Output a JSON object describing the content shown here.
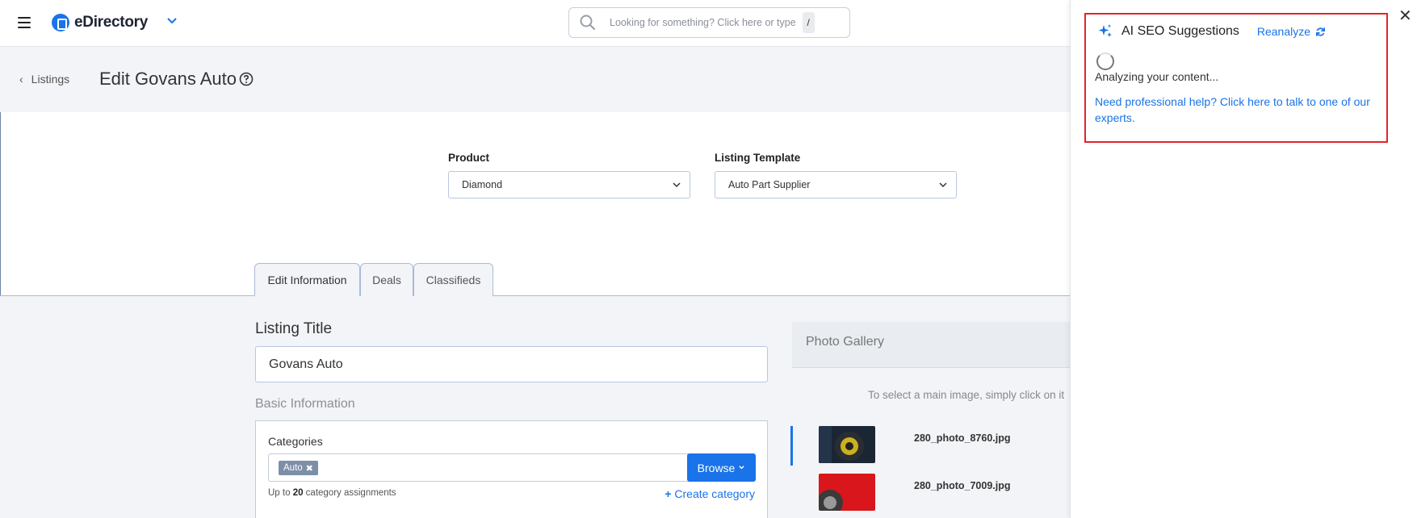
{
  "header": {
    "brand": "eDirectory",
    "search_placeholder": "Looking for something? Click here or type",
    "search_shortcut": "/"
  },
  "page": {
    "back_label": "Listings",
    "title": "Edit Govans Auto"
  },
  "selectors": {
    "product_label": "Product",
    "product_value": "Diamond",
    "template_label": "Listing Template",
    "template_value": "Auto Part Supplier"
  },
  "tabs": [
    {
      "label": "Edit Information",
      "active": true
    },
    {
      "label": "Deals",
      "active": false
    },
    {
      "label": "Classifieds",
      "active": false
    }
  ],
  "form": {
    "listing_title_label": "Listing Title",
    "listing_title_value": "Govans Auto",
    "basic_info_label": "Basic Information",
    "categories_label": "Categories",
    "category_chips": [
      "Auto"
    ],
    "browse_label": "Browse",
    "hint_prefix": "Up to ",
    "hint_count": "20",
    "hint_suffix": " category assignments",
    "create_category_label": "Create category"
  },
  "gallery": {
    "title": "Photo Gallery",
    "hint": "To select a main image, simply click on it",
    "photos": [
      {
        "name": "280_photo_8760.jpg"
      },
      {
        "name": "280_photo_7009.jpg"
      }
    ]
  },
  "ai_panel": {
    "title": "AI SEO Suggestions",
    "reanalyze_label": "Reanalyze",
    "status": "Analyzing your content...",
    "help_link": "Need professional help? Click here to talk to one of our experts.",
    "close_glyph": "✕"
  },
  "colors": {
    "accent": "#1a73e8",
    "highlight_border": "#e3242b",
    "page_bg": "#f2f4f7"
  }
}
